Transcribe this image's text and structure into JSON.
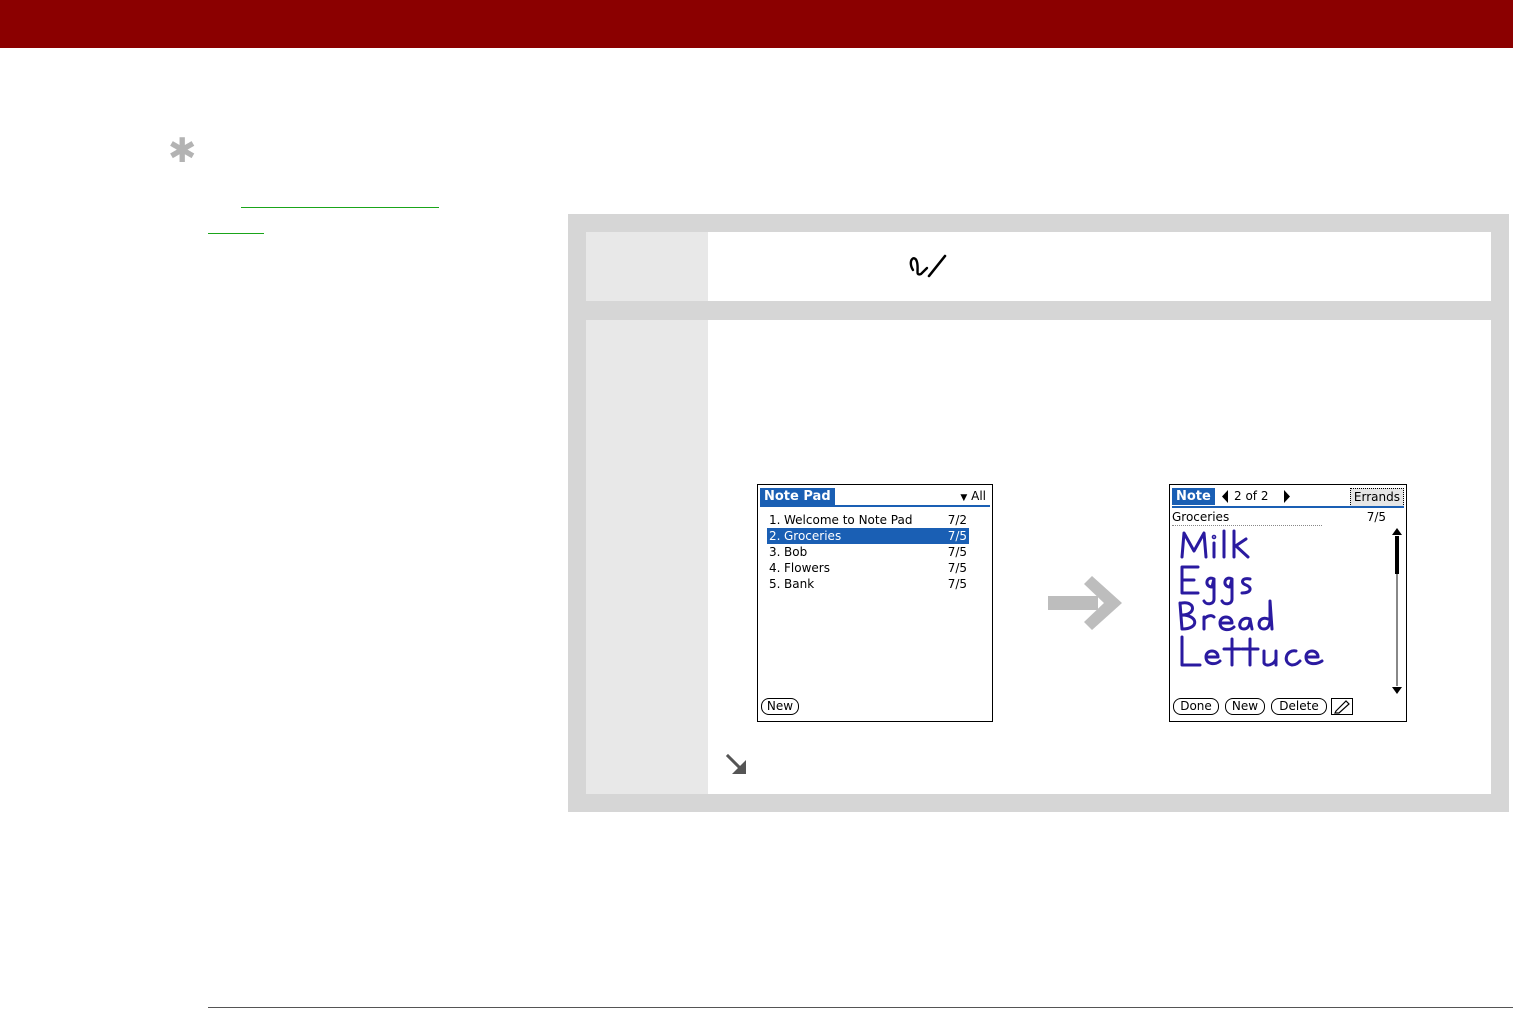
{
  "colors": {
    "header_bar": "#8b0000",
    "link": "#1aa51a",
    "panel": "#d6d6d6",
    "palm_accent": "#1a5fb4",
    "ink": "#2a1aa0"
  },
  "sidebar": {
    "tip_icon": "asterisk-icon"
  },
  "step1": {
    "icon": "note-pad-pencil-icon"
  },
  "note_list_screen": {
    "title": "Note Pad",
    "category": "All",
    "items": [
      {
        "num": "1.",
        "title": "Welcome to Note Pad",
        "date": "7/2",
        "selected": false
      },
      {
        "num": "2.",
        "title": "Groceries",
        "date": "7/5",
        "selected": true
      },
      {
        "num": "3.",
        "title": "Bob",
        "date": "7/5",
        "selected": false
      },
      {
        "num": "4.",
        "title": "Flowers",
        "date": "7/5",
        "selected": false
      },
      {
        "num": "5.",
        "title": "Bank",
        "date": "7/5",
        "selected": false
      }
    ],
    "new_button": "New"
  },
  "note_detail_screen": {
    "title": "Note",
    "record_position": "2 of 2",
    "category": "Errands",
    "note_title": "Groceries",
    "note_date": "7/5",
    "handwriting": [
      "Milk",
      "Eggs",
      "Bread",
      "Lettuce"
    ],
    "buttons": {
      "done": "Done",
      "new": "New",
      "delete": "Delete"
    }
  },
  "transition_icon": "right-arrow-icon",
  "continue_icon": "continue-arrow-icon"
}
